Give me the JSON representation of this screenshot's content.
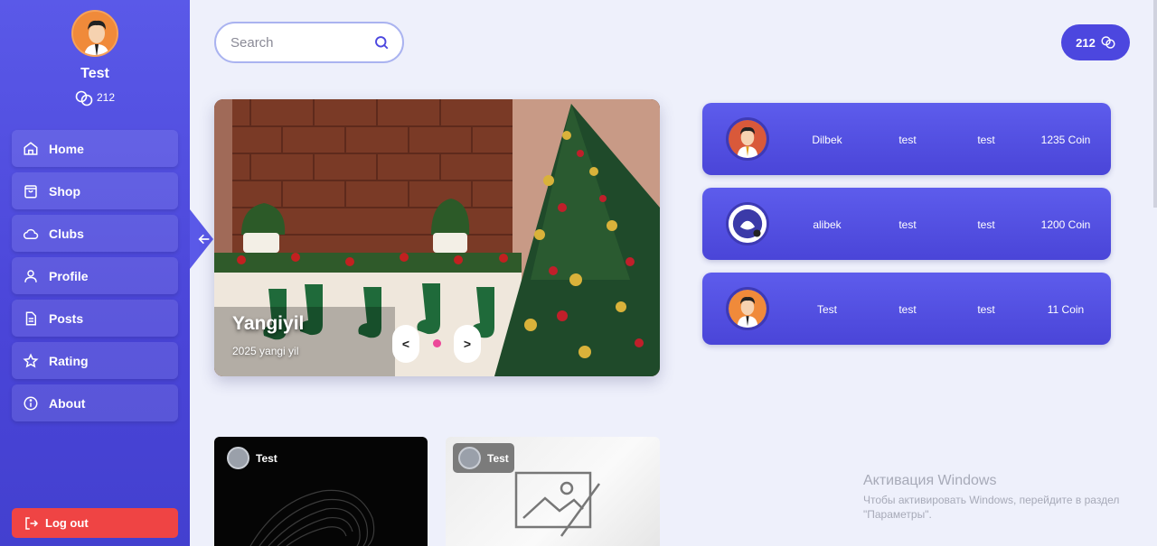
{
  "user": {
    "name": "Test",
    "coins": "212"
  },
  "sidebar": {
    "items": [
      {
        "label": "Home",
        "icon": "home-icon"
      },
      {
        "label": "Shop",
        "icon": "shopping-bag-icon"
      },
      {
        "label": "Clubs",
        "icon": "cloud-icon"
      },
      {
        "label": "Profile",
        "icon": "user-icon"
      },
      {
        "label": "Posts",
        "icon": "document-icon"
      },
      {
        "label": "Rating",
        "icon": "star-icon"
      },
      {
        "label": "About",
        "icon": "info-icon"
      }
    ],
    "logout_label": "Log out"
  },
  "search": {
    "placeholder": "Search"
  },
  "header": {
    "coins": "212"
  },
  "banner": {
    "title": "Yangiyil",
    "subtitle": "2025 yangi yil",
    "prev_label": "<",
    "next_label": ">"
  },
  "leaderboard": [
    {
      "name": "Dilbek",
      "col2": "test",
      "col3": "test",
      "coins": "1235 Coin"
    },
    {
      "name": "alibek",
      "col2": "test",
      "col3": "test",
      "coins": "1200 Coin"
    },
    {
      "name": "Test",
      "col2": "test",
      "col3": "test",
      "coins": "11 Coin"
    }
  ],
  "posts": [
    {
      "author": "Test"
    },
    {
      "author": "Test"
    }
  ],
  "watermark": {
    "title": "Активация Windows",
    "subtitle": "Чтобы активировать Windows, перейдите в раздел \"Параметры\"."
  },
  "colors": {
    "accent": "#4c47df",
    "logout": "#ef4444",
    "dot": "#ec4899"
  }
}
